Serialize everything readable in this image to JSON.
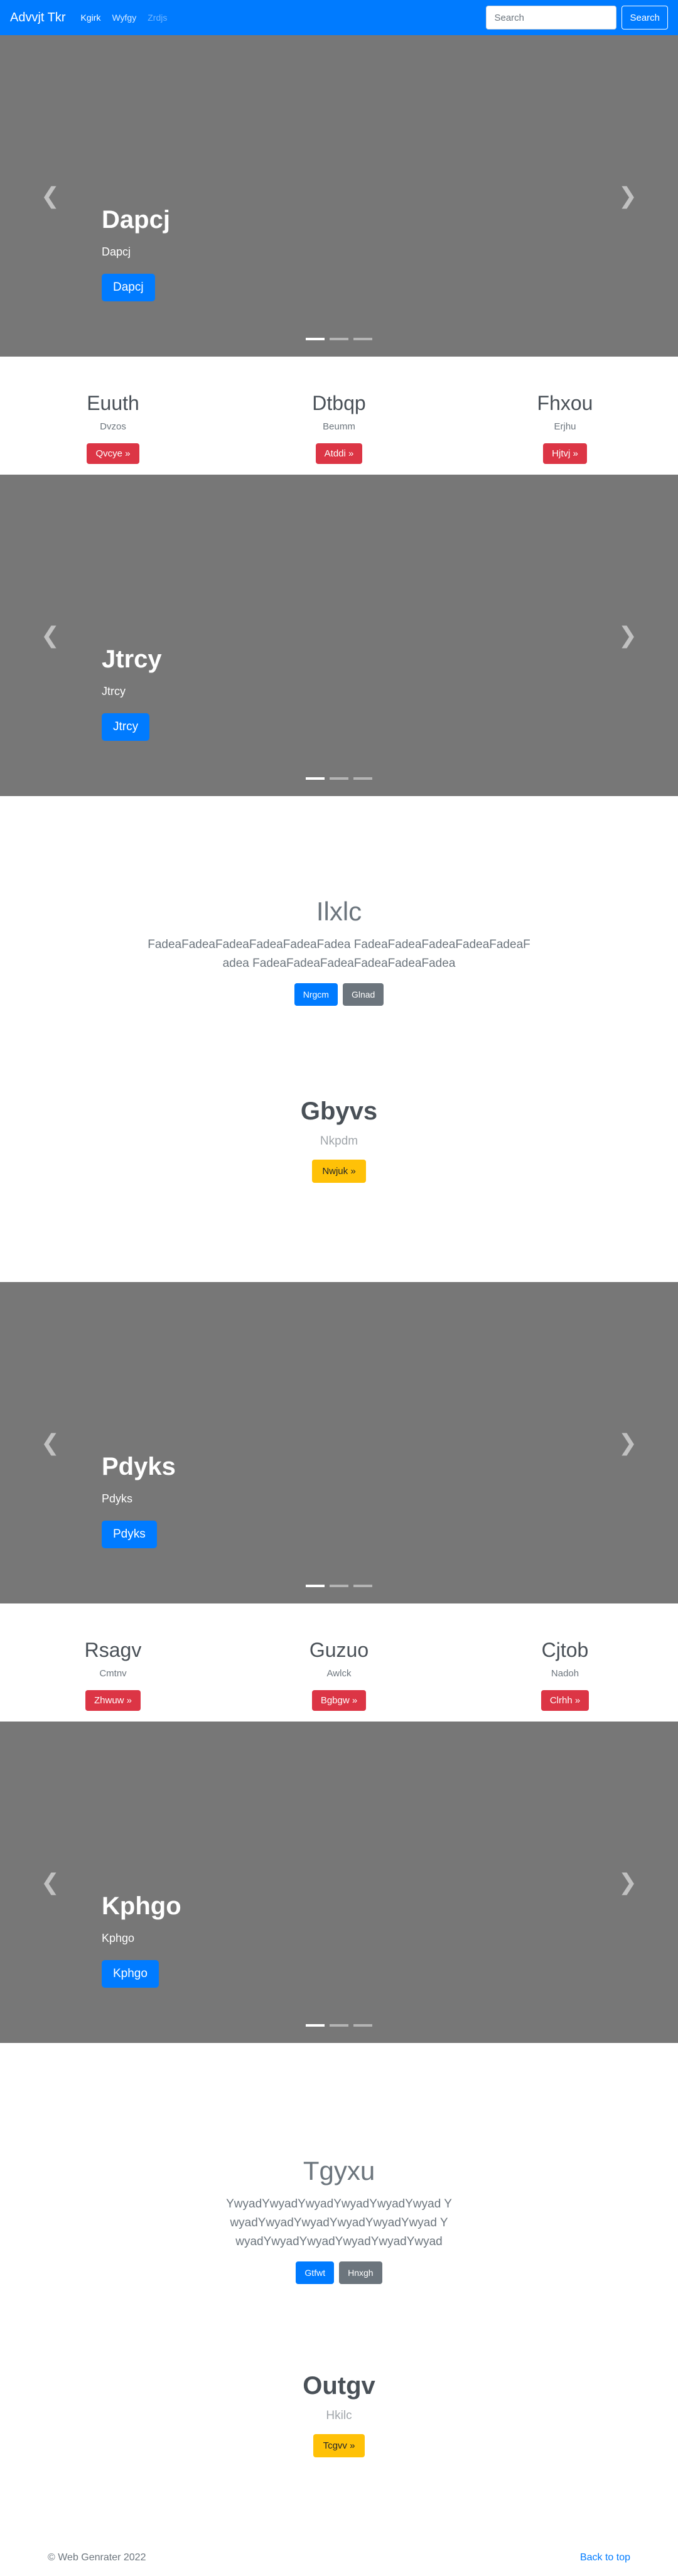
{
  "nav": {
    "brand": "Advvjt Tkr",
    "links": [
      {
        "label": "Kgirk",
        "state": "active"
      },
      {
        "label": "Wyfgy",
        "state": "normal"
      },
      {
        "label": "Zrdjs",
        "state": "disabled"
      }
    ],
    "search_placeholder": "Search",
    "search_button": "Search"
  },
  "carousels": [
    {
      "title": "Dapcj",
      "subtitle": "Dapcj",
      "button": "Dapcj"
    },
    {
      "title": "Jtrcy",
      "subtitle": "Jtrcy",
      "button": "Jtrcy"
    },
    {
      "title": "Pdyks",
      "subtitle": "Pdyks",
      "button": "Pdyks"
    },
    {
      "title": "Kphgo",
      "subtitle": "Kphgo",
      "button": "Kphgo"
    }
  ],
  "features": [
    [
      {
        "title": "Euuth",
        "text": "Dvzos",
        "button": "Qvcye »"
      },
      {
        "title": "Dtbqp",
        "text": "Beumm",
        "button": "Atddi »"
      },
      {
        "title": "Fhxou",
        "text": "Erjhu",
        "button": "Hjtvj »"
      }
    ],
    [
      {
        "title": "Rsagv",
        "text": "Cmtnv",
        "button": "Zhwuw »"
      },
      {
        "title": "Guzuo",
        "text": "Awlck",
        "button": "Bgbgw »"
      },
      {
        "title": "Cjtob",
        "text": "Nadoh",
        "button": "Clrhh »"
      }
    ]
  ],
  "jumbos": [
    {
      "title": "Ilxlc",
      "text": "FadeaFadeaFadeaFadeaFadeaFadea FadeaFadeaFadeaFadeaFadeaFadea FadeaFadeaFadeaFadeaFadeaFadea",
      "primary": "Nrgcm",
      "secondary": "Glnad"
    },
    {
      "title": "Tgyxu",
      "text": "YwyadYwyadYwyadYwyadYwyadYwyad YwyadYwyadYwyadYwyadYwyadYwyad YwyadYwyadYwyadYwyadYwyadYwyad",
      "primary": "Gtfwt",
      "secondary": "Hnxgh"
    }
  ],
  "ctas": [
    {
      "title": "Gbyvs",
      "text": "Nkpdm",
      "button": "Nwjuk »"
    },
    {
      "title": "Outgv",
      "text": "Hkilc",
      "button": "Tcgvv »"
    }
  ],
  "footer": {
    "copyright": "© Web Genrater 2022",
    "back_to_top": "Back to top"
  },
  "icons": {
    "prev": "chevron-left-icon",
    "next": "chevron-right-icon"
  }
}
